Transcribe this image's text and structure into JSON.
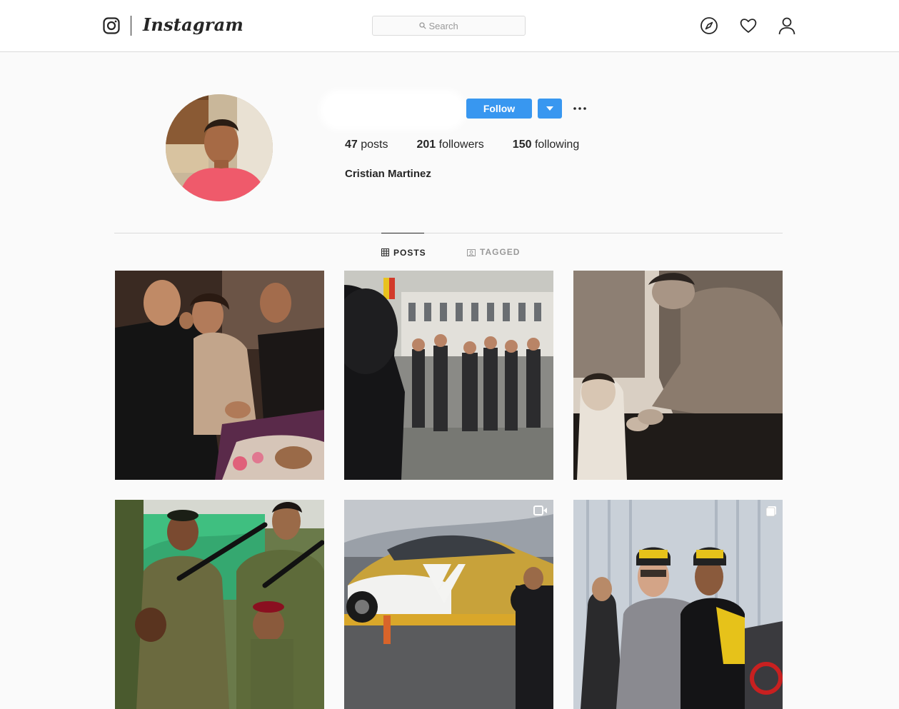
{
  "app": {
    "wordmark": "Instagram"
  },
  "search": {
    "placeholder": "Search"
  },
  "nav": {
    "icons": [
      "compass-icon",
      "heart-icon",
      "user-icon"
    ]
  },
  "profile": {
    "full_name": "Cristian Martinez",
    "follow_label": "Follow",
    "stats": {
      "posts": "47",
      "posts_label": "posts",
      "followers": "201",
      "followers_label": "followers",
      "following": "150",
      "following_label": "following"
    }
  },
  "tabs": [
    {
      "label": "POSTS",
      "icon": "grid-icon",
      "active": true
    },
    {
      "label": "TAGGED",
      "icon": "tagged-icon",
      "active": false
    }
  ],
  "posts": [
    {
      "badge": ""
    },
    {
      "badge": ""
    },
    {
      "badge": ""
    },
    {
      "badge": ""
    },
    {
      "badge": "video-icon"
    },
    {
      "badge": "carousel-icon"
    }
  ],
  "colors": {
    "accent": "#3897f0",
    "text": "#262626",
    "muted": "#999999",
    "border": "#dbdbdb",
    "background": "#fafafa"
  }
}
